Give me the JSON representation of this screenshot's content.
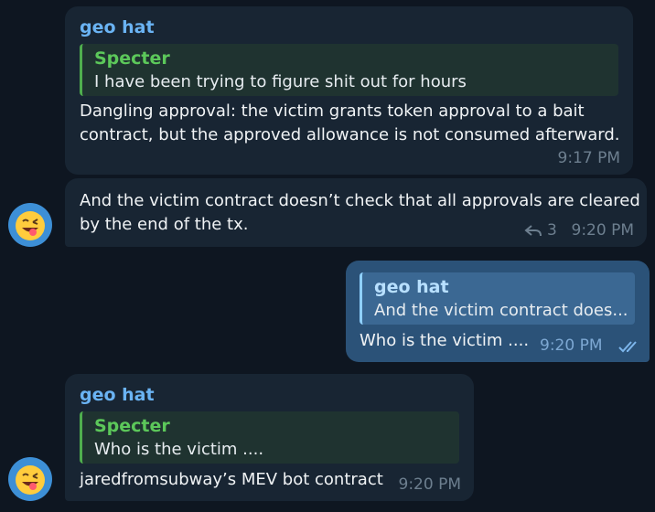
{
  "messages": [
    {
      "sender": "geo hat",
      "quote": {
        "name": "Specter",
        "text": "I have been trying to figure shit out for hours"
      },
      "lines": [
        "Dangling approval: the victim grants token approval to a bait",
        "contract, but the approved allowance is not consumed afterward."
      ],
      "time": "9:17 PM"
    },
    {
      "lines": [
        "And the victim contract doesn’t check that all approvals are cleared",
        "by the end of the tx."
      ],
      "replies": "3",
      "time": "9:20 PM",
      "avatar_icon": "grinning-face-with-tongue-emoji"
    },
    {
      "outgoing": true,
      "quote": {
        "name": "geo hat",
        "text": "And the victim contract does..."
      },
      "text": "Who is the victim ....",
      "time": "9:20 PM",
      "status_icon": "double-check-read-icon"
    },
    {
      "sender": "geo hat",
      "quote": {
        "name": "Specter",
        "text": "Who is the victim ...."
      },
      "text": "jaredfromsubway’s MEV bot contract",
      "time": "9:20 PM",
      "avatar_icon": "grinning-face-with-tongue-emoji"
    }
  ],
  "colors": {
    "background": "#0e1621",
    "incoming_bubble": "#182533",
    "outgoing_bubble": "#2b5278",
    "sender_name": "#6ab3f3",
    "quote_accent": "#4fae4e"
  }
}
